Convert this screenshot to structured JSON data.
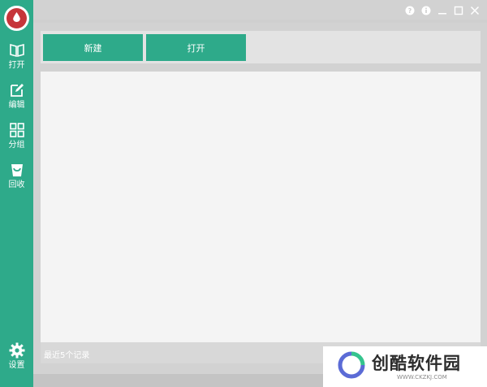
{
  "app": {
    "logo_icon": "droplet-logo",
    "accent": "#2eaa8a",
    "logo_color": "#c6353a"
  },
  "sidebar": {
    "items": [
      {
        "label": "打开",
        "icon": "book-open-icon"
      },
      {
        "label": "编辑",
        "icon": "edit-icon"
      },
      {
        "label": "分组",
        "icon": "grid-icon"
      },
      {
        "label": "回收",
        "icon": "recycle-bin-icon"
      }
    ],
    "settings": {
      "label": "设置",
      "icon": "gear-icon"
    }
  },
  "window_controls": {
    "help_icon": "help-icon",
    "info_icon": "info-icon",
    "minimize_icon": "minimize-icon",
    "maximize_icon": "maximize-icon",
    "close_icon": "close-icon"
  },
  "toolbar": {
    "new_label": "新建",
    "open_label": "打开"
  },
  "footer": {
    "recent_text": "最近5个记录"
  },
  "watermark": {
    "name": "创酷软件园",
    "url": "WWW.CKZKJ.COM"
  }
}
